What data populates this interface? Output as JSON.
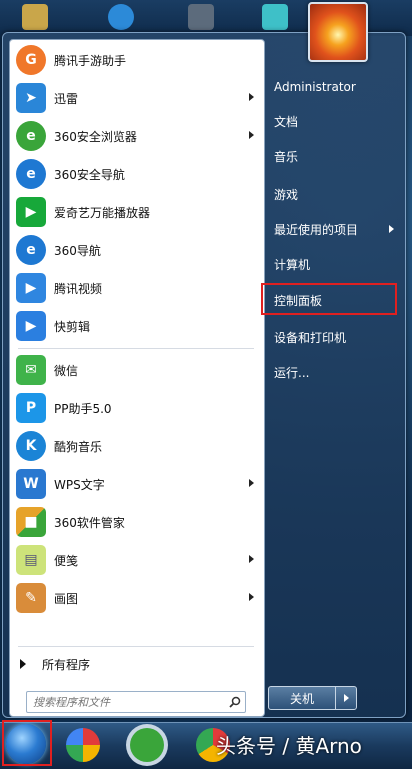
{
  "start_menu": {
    "pinned": [
      {
        "label": "腾讯手游助手",
        "icon": "tencent-game-assistant-icon",
        "color": "#f0772a",
        "has_arrow": false
      },
      {
        "label": "迅雷",
        "icon": "thunder-icon",
        "color": "#2a86d8",
        "has_arrow": true
      },
      {
        "label": "360安全浏览器",
        "icon": "360-browser-icon",
        "color": "#3aa53a",
        "has_arrow": true
      },
      {
        "label": "360安全导航",
        "icon": "ie-icon",
        "color": "#1e78d2",
        "has_arrow": false
      },
      {
        "label": "爱奇艺万能播放器",
        "icon": "iqiyi-icon",
        "color": "#17a83a",
        "has_arrow": false
      },
      {
        "label": "360导航",
        "icon": "ie-icon",
        "color": "#1e78d2",
        "has_arrow": false
      },
      {
        "label": "腾讯视频",
        "icon": "tencent-video-icon",
        "color": "#2f86e0",
        "has_arrow": false
      },
      {
        "label": "快剪辑",
        "icon": "kuaijianji-icon",
        "color": "#2b7fe0",
        "has_arrow": false
      }
    ],
    "recent": [
      {
        "label": "微信",
        "icon": "wechat-icon",
        "color": "#3fb34a",
        "has_arrow": false
      },
      {
        "label": "PP助手5.0",
        "icon": "pp-assistant-icon",
        "color": "#1c96e8",
        "has_arrow": false
      },
      {
        "label": "酷狗音乐",
        "icon": "kugou-icon",
        "color": "#1b84d6",
        "has_arrow": false
      },
      {
        "label": "WPS文字",
        "icon": "wps-icon",
        "color": "#2a78d0",
        "has_arrow": true
      },
      {
        "label": "360软件管家",
        "icon": "360-software-icon",
        "color": "#e6a32a",
        "has_arrow": false
      },
      {
        "label": "便笺",
        "icon": "sticky-notes-icon",
        "color": "#cde37a",
        "has_arrow": true
      },
      {
        "label": "画图",
        "icon": "paint-icon",
        "color": "#d98c3a",
        "has_arrow": true
      }
    ],
    "all_programs": "所有程序",
    "search_placeholder": "搜索程序和文件"
  },
  "right_panel": {
    "items": [
      {
        "label": "Administrator",
        "has_arrow": false
      },
      {
        "label": "文档",
        "has_arrow": false
      },
      {
        "label": "音乐",
        "has_arrow": false
      },
      {
        "label": "游戏",
        "has_arrow": false
      },
      {
        "label": "最近使用的项目",
        "has_arrow": true
      },
      {
        "label": "计算机",
        "has_arrow": false
      },
      {
        "label": "控制面板",
        "has_arrow": false
      },
      {
        "label": "设备和打印机",
        "has_arrow": false
      },
      {
        "label": "运行...",
        "has_arrow": false
      }
    ],
    "shutdown_label": "关机"
  },
  "taskbar": {
    "watermark": "头条号 / 黄Arno"
  },
  "colors": {
    "highlight_border": "#e02020"
  }
}
